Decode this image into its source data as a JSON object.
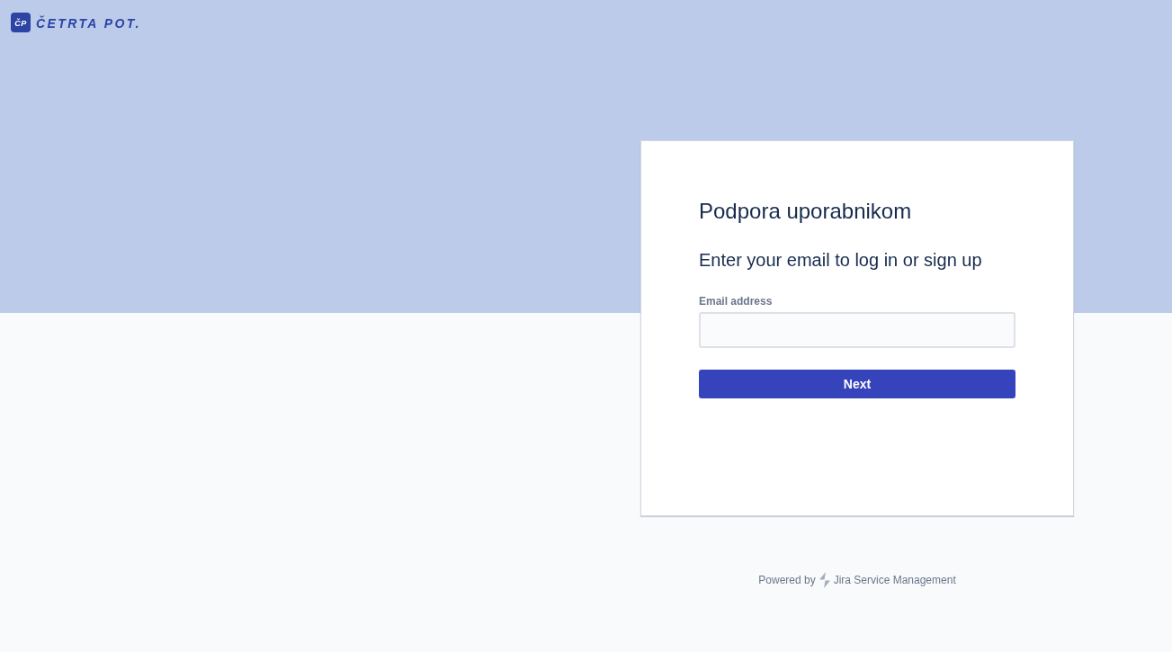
{
  "header": {
    "logo": {
      "mark": "ČP",
      "wordmark": "ČETRTA POT."
    }
  },
  "login_card": {
    "title": "Podpora uporabnikom",
    "subtitle": "Enter your email to log in or sign up",
    "email_field": {
      "label": "Email address"
    },
    "submit_button": "Next"
  },
  "footer": {
    "prefix": "Powered by",
    "product": "Jira Service Management"
  }
}
